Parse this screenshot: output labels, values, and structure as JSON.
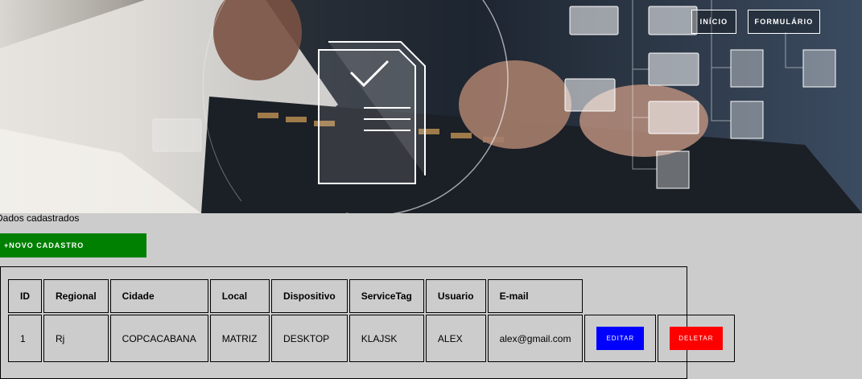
{
  "nav": {
    "inicio_label": "INÍCIO",
    "formulario_label": "FORMULÁRIO"
  },
  "section": {
    "title": "Dados cadastrados",
    "new_button_label": "+NOVO CADASTRO"
  },
  "table": {
    "headers": [
      "ID",
      "Regional",
      "Cidade",
      "Local",
      "Dispositivo",
      "ServiceTag",
      "Usuario",
      "E-mail"
    ],
    "rows": [
      {
        "id": "1",
        "regional": "Rj",
        "cidade": "COPCACABANA",
        "local": "MATRIZ",
        "dispositivo": "DESKTOP",
        "servicetag": "KLAJSK",
        "usuario": "ALEX",
        "email": "alex@gmail.com",
        "edit_label": "EDITAR",
        "delete_label": "DELETAR"
      }
    ]
  },
  "colors": {
    "background": "#cccccc",
    "new_button": "#008000",
    "edit_button": "#0000ff",
    "delete_button": "#ff0000"
  },
  "hero": {
    "icons": [
      "document-check-icon",
      "folder-icon",
      "file-icon"
    ]
  }
}
